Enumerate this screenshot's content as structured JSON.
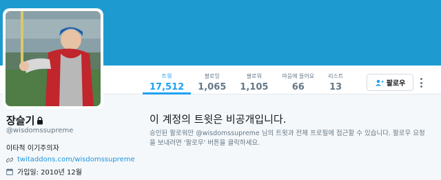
{
  "profile": {
    "name": "장슬기",
    "handle": "@wisdomssupreme",
    "bio": "이타적 이기주의자",
    "url": "twitaddons.com/wisdomssupreme",
    "joined": "가입일: 2010년 12월"
  },
  "stats": [
    {
      "label": "트윗",
      "value": "17,512"
    },
    {
      "label": "팔로잉",
      "value": "1,065"
    },
    {
      "label": "팔로워",
      "value": "1,105"
    },
    {
      "label": "마음에 들어요",
      "value": "66"
    },
    {
      "label": "리스트",
      "value": "13"
    }
  ],
  "actions": {
    "follow_label": "팔로우"
  },
  "protected": {
    "title": "이 계정의 트윗은 비공개입니다.",
    "description": "승인된 팔로워만 @wisdomssupreme 님의 트윗과 전체 프로필에 접근할 수 있습니다. 팔로우 요청을 보내려면 '팔로우' 버튼을 클릭하세요."
  },
  "colors": {
    "banner": "#1d9bd1",
    "accent": "#1da1f2",
    "link": "#1b95e0"
  },
  "icons": {
    "lock": "lock-icon",
    "link": "link-icon",
    "calendar": "calendar-icon",
    "follow": "add-person-icon",
    "more": "more-vertical-icon"
  }
}
